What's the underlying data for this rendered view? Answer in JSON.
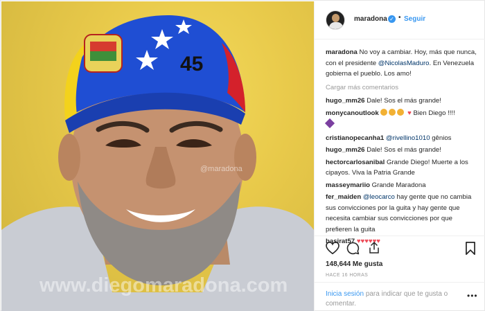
{
  "photo": {
    "watermark_small": "@maradona",
    "watermark_large": "www.diegomaradona.com",
    "cap_number": "45"
  },
  "header": {
    "username": "maradona",
    "verified_icon": "verified-check-icon",
    "separator": "•",
    "follow_label": "Seguir"
  },
  "caption": {
    "user": "maradona",
    "text_1": "No voy a cambiar. Hoy, más que nunca, con el presidente",
    "mention": "@NicolasMaduro",
    "text_2": ". En Venezuela gobierna el pueblo. Los amo!"
  },
  "load_more": "Cargar más comentarios",
  "comments": [
    {
      "user": "hugo_mm26",
      "text": "Dale! Sos el más grande!"
    },
    {
      "user": "monycanoutlook",
      "text": "Bien Diego !!!!"
    },
    {
      "user": "cristianopecanha1",
      "mention": "@rivellino1010",
      "text": "gênios"
    },
    {
      "user": "hugo_mm26",
      "text": "Dale! Sos el más grande!"
    },
    {
      "user": "hectorcarlosanibal",
      "text": "Grande Diego! Muerte a los cipayos. Viva la Patria Grande"
    },
    {
      "user": "masseymariio",
      "text": "Grande Maradona"
    },
    {
      "user": "fer_maiden",
      "mention": "@leocarco",
      "text": "hay gente que no cambia sus convicciones por la guita y hay gente que necesita cambiar sus convicciones por que prefieren la guita"
    },
    {
      "user": "basirat57",
      "text": ""
    }
  ],
  "likes": "148,644 Me gusta",
  "time": "HACE 16 HORAS",
  "footer": {
    "login_link": "Inicia sesión",
    "login_text": "para indicar que te gusta o comentar.",
    "more_label": "•••"
  },
  "colors": {
    "link": "#3897f0",
    "mention": "#003569",
    "heart": "#ed4956"
  }
}
